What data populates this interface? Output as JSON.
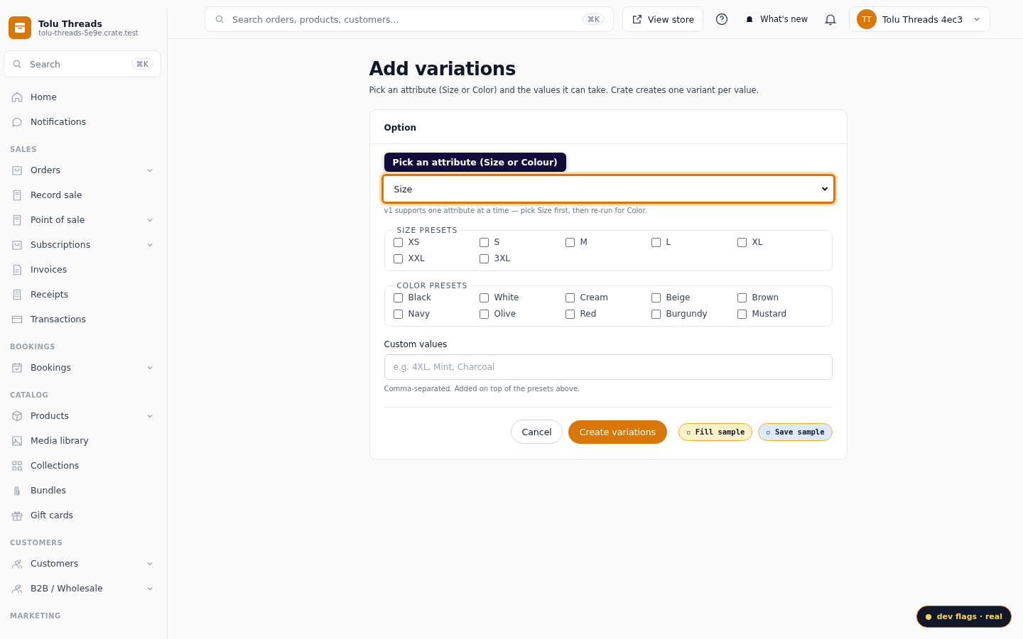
{
  "brand": {
    "name": "Tolu Threads",
    "domain": "tolu-threads-5e9e.crate.test"
  },
  "sidebar_search": {
    "placeholder": "Search",
    "shortcut": "⌘K"
  },
  "nav": [
    {
      "kind": "item",
      "label": "Home",
      "expandable": false
    },
    {
      "kind": "item",
      "label": "Notifications",
      "expandable": false
    },
    {
      "kind": "section",
      "label": "SALES"
    },
    {
      "kind": "item",
      "label": "Orders",
      "expandable": true
    },
    {
      "kind": "item",
      "label": "Record sale",
      "expandable": false
    },
    {
      "kind": "item",
      "label": "Point of sale",
      "expandable": true
    },
    {
      "kind": "item",
      "label": "Subscriptions",
      "expandable": true
    },
    {
      "kind": "item",
      "label": "Invoices",
      "expandable": false
    },
    {
      "kind": "item",
      "label": "Receipts",
      "expandable": false
    },
    {
      "kind": "item",
      "label": "Transactions",
      "expandable": false
    },
    {
      "kind": "section",
      "label": "BOOKINGS"
    },
    {
      "kind": "item",
      "label": "Bookings",
      "expandable": true
    },
    {
      "kind": "section",
      "label": "CATALOG"
    },
    {
      "kind": "item",
      "label": "Products",
      "expandable": true
    },
    {
      "kind": "item",
      "label": "Media library",
      "expandable": false
    },
    {
      "kind": "item",
      "label": "Collections",
      "expandable": false
    },
    {
      "kind": "item",
      "label": "Bundles",
      "expandable": false
    },
    {
      "kind": "item",
      "label": "Gift cards",
      "expandable": false
    },
    {
      "kind": "section",
      "label": "CUSTOMERS"
    },
    {
      "kind": "item",
      "label": "Customers",
      "expandable": true
    },
    {
      "kind": "item",
      "label": "B2B / Wholesale",
      "expandable": true
    },
    {
      "kind": "section",
      "label": "MARKETING"
    }
  ],
  "topbar": {
    "search_placeholder": "Search orders, products, customers...",
    "shortcut": "⌘K",
    "view_store": "View store",
    "whats_new": "What's new",
    "avatar_initials": "TT",
    "account": "Tolu Threads 4ec3"
  },
  "page": {
    "title": "Add variations",
    "subtitle": "Pick an attribute (Size or Color) and the values it can take. Crate creates one variant per value."
  },
  "card": {
    "title": "Option",
    "tooltip": "Pick an attribute (Size or Colour)",
    "attribute_value": "Size",
    "attribute_help": "v1 supports one attribute at a time — pick Size first, then re-run for Color.",
    "groups": [
      {
        "legend": "SIZE PRESETS",
        "options": [
          {
            "label": "XS",
            "checked": false
          },
          {
            "label": "S",
            "checked": false
          },
          {
            "label": "M",
            "checked": false
          },
          {
            "label": "L",
            "checked": false
          },
          {
            "label": "XL",
            "checked": false
          },
          {
            "label": "XXL",
            "checked": false
          },
          {
            "label": "3XL",
            "checked": false
          }
        ]
      },
      {
        "legend": "COLOR PRESETS",
        "options": [
          {
            "label": "Black",
            "checked": false
          },
          {
            "label": "White",
            "checked": false
          },
          {
            "label": "Cream",
            "checked": false
          },
          {
            "label": "Beige",
            "checked": false
          },
          {
            "label": "Brown",
            "checked": false
          },
          {
            "label": "Navy",
            "checked": false
          },
          {
            "label": "Olive",
            "checked": false
          },
          {
            "label": "Red",
            "checked": false
          },
          {
            "label": "Burgundy",
            "checked": false
          },
          {
            "label": "Mustard",
            "checked": false
          }
        ]
      }
    ],
    "custom_label": "Custom values",
    "custom_placeholder": "e.g. 4XL, Mint, Charcoal",
    "custom_help": "Comma-separated. Added on top of the presets above.",
    "cancel": "Cancel",
    "create": "Create variations",
    "fill_sample": "▫ Fill sample",
    "save_sample": "▫ Save sample"
  },
  "dev_badge": "dev flags · real"
}
